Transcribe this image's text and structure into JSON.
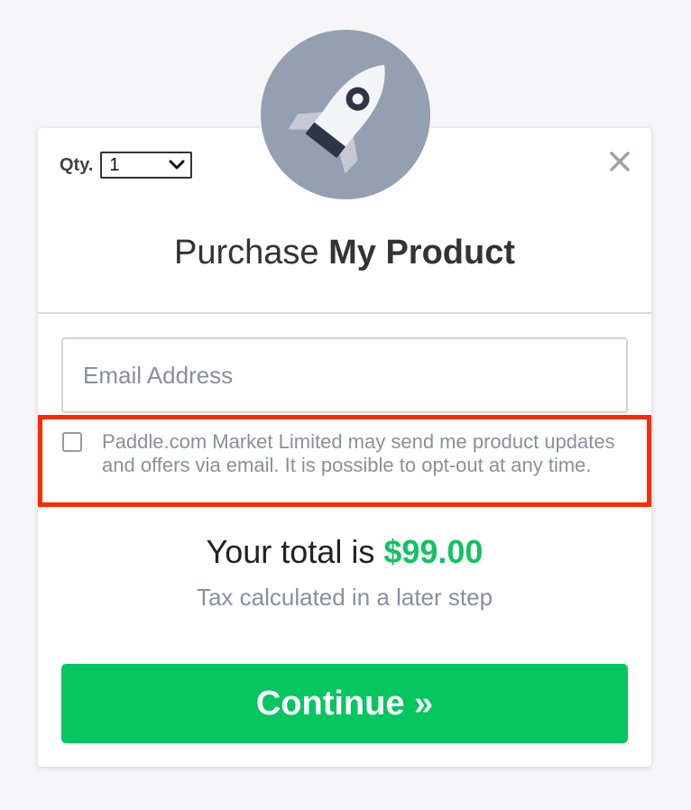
{
  "product": {
    "title_prefix": "Purchase",
    "title_name": "My Product",
    "logo_icon": "rocket-icon"
  },
  "quantity": {
    "label": "Qty.",
    "value": "1"
  },
  "close_icon": "close-icon",
  "email": {
    "placeholder": "Email Address",
    "value": ""
  },
  "consent": {
    "checked": false,
    "text": "Paddle.com Market Limited may send me product updates and offers via email. It is possible to opt-out at any time."
  },
  "total": {
    "prefix": "Your total is",
    "amount": "$99.00",
    "tax_note": "Tax calculated in a later step"
  },
  "continue_label": "Continue »",
  "colors": {
    "accent_green": "#06c660",
    "price_green": "#13c264",
    "logo_bg": "#949fb1",
    "highlight": "#ff2a00"
  }
}
